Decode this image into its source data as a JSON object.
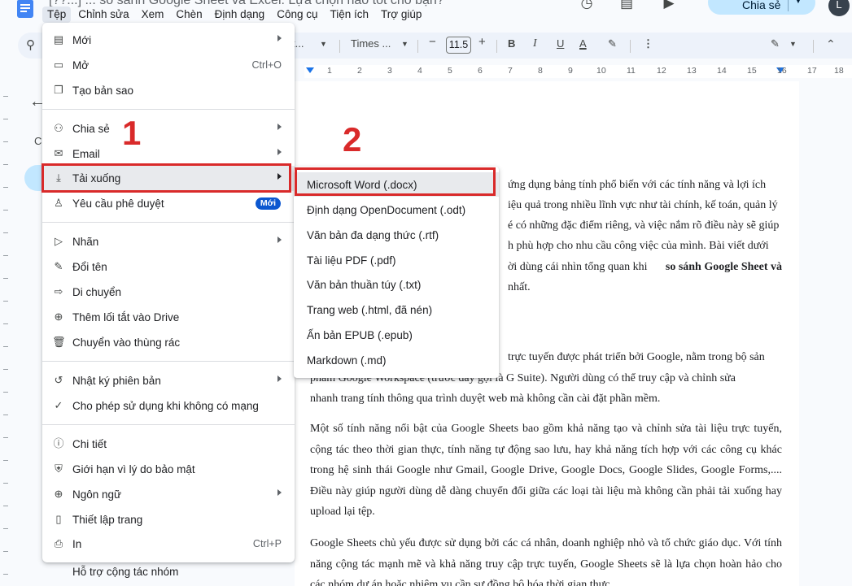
{
  "app": {
    "doc_title": "[??...] ... so sánh Google Sheet và Excel: Lựa chọn nào tốt cho bạn?",
    "menubar": [
      "Tệp",
      "Chỉnh sửa",
      "Xem",
      "Chèn",
      "Định dạng",
      "Công cụ",
      "Tiện ích",
      "Trợ giúp"
    ],
    "share_label": "Chia sẻ",
    "avatar_letter": "L"
  },
  "toolbar": {
    "style_label": "t...",
    "font_label": "Times ...",
    "font_size": "11.5",
    "bold": "B",
    "italic": "I",
    "underline": "U",
    "text_color": "A",
    "minus": "−",
    "plus": "+",
    "more": "⋮"
  },
  "ruler": [
    "1",
    "2",
    "3",
    "4",
    "5",
    "6",
    "7",
    "8",
    "9",
    "10",
    "11",
    "12",
    "13",
    "14",
    "15",
    "16",
    "17",
    "18"
  ],
  "file_menu": {
    "items": [
      {
        "icon": "new-doc-icon",
        "glyph": "▤",
        "label": "Mới",
        "shortcut": "",
        "submenu": true
      },
      {
        "icon": "folder-open-icon",
        "glyph": "▭",
        "label": "Mở",
        "shortcut": "Ctrl+O",
        "submenu": false
      },
      {
        "icon": "copy-icon",
        "glyph": "❐",
        "label": "Tạo bản sao",
        "shortcut": "",
        "submenu": false
      },
      {
        "icon": "person-add-icon",
        "glyph": "⚇",
        "label": "Chia sẻ",
        "shortcut": "",
        "submenu": true
      },
      {
        "icon": "mail-icon",
        "glyph": "✉",
        "label": "Email",
        "shortcut": "",
        "submenu": true
      },
      {
        "icon": "download-icon",
        "glyph": "⤓",
        "label": "Tải xuống",
        "shortcut": "",
        "submenu": true
      },
      {
        "icon": "approval-icon",
        "glyph": "♙",
        "label": "Yêu cầu phê duyệt",
        "shortcut": "",
        "submenu": false,
        "badge": "Mới"
      },
      {
        "icon": "label-icon",
        "glyph": "▷",
        "label": "Nhãn",
        "shortcut": "",
        "submenu": true
      },
      {
        "icon": "rename-icon",
        "glyph": "✎",
        "label": "Đổi tên",
        "shortcut": "",
        "submenu": false
      },
      {
        "icon": "move-icon",
        "glyph": "⇨",
        "label": "Di chuyển",
        "shortcut": "",
        "submenu": false
      },
      {
        "icon": "drive-shortcut-icon",
        "glyph": "⊕",
        "label": "Thêm lối tắt vào Drive",
        "shortcut": "",
        "submenu": false
      },
      {
        "icon": "trash-icon",
        "glyph": "🗑",
        "label": "Chuyển vào thùng rác",
        "shortcut": "",
        "submenu": false
      },
      {
        "icon": "history-icon",
        "glyph": "↺",
        "label": "Nhật ký phiên bản",
        "shortcut": "",
        "submenu": true
      },
      {
        "icon": "offline-icon",
        "glyph": "✓",
        "label": "Cho phép sử dụng khi không có mạng",
        "shortcut": "",
        "submenu": false
      },
      {
        "icon": "info-icon",
        "glyph": "ⓘ",
        "label": "Chi tiết",
        "shortcut": "",
        "submenu": false
      },
      {
        "icon": "security-icon",
        "glyph": "⛨",
        "label": "Giới hạn vì lý do bảo mật",
        "shortcut": "",
        "submenu": false
      },
      {
        "icon": "globe-icon",
        "glyph": "⊕",
        "label": "Ngôn ngữ",
        "shortcut": "",
        "submenu": true
      },
      {
        "icon": "page-setup-icon",
        "glyph": "▯",
        "label": "Thiết lập trang",
        "shortcut": "",
        "submenu": false
      },
      {
        "icon": "print-icon",
        "glyph": "⎙",
        "label": "In",
        "shortcut": "Ctrl+P",
        "submenu": false
      }
    ]
  },
  "download_submenu": {
    "items": [
      "Microsoft Word (.docx)",
      "Định dạng OpenDocument (.odt)",
      "Văn bản đa dạng thức (.rtf)",
      "Tài liệu PDF (.pdf)",
      "Văn bản thuần túy (.txt)",
      "Trang web (.html, đã nén)",
      "Ấn bản EPUB (.epub)",
      "Markdown (.md)"
    ]
  },
  "annotations": {
    "step1": "1",
    "step2": "2",
    "color": "#d92a2a"
  },
  "outline": {
    "collapsed_letter": "C",
    "footer_item": "Hỗ trợ cộng tác nhóm"
  },
  "document": {
    "visible_fragments": [
      "ứng dụng bảng tính phổ biến với các tính năng và lợi ích",
      "iệu quả trong nhiều lĩnh vực như tài chính, kế toán, quản lý",
      "é có những đặc điểm riêng, và việc nắm rõ điều này sẽ giúp",
      "h phù hợp cho nhu cầu công việc của mình. Bài viết dưới",
      "ời dùng cái nhìn tổng quan khi",
      "so sánh Google Sheet và",
      "nhất.",
      "trực tuyến được phát triển bởi Google, nằm trong bộ sản",
      "phẩm Google Workspace (trước đây gọi là G Suite). Người dùng có thể truy cập và chỉnh sửa",
      "nhanh trang tính thông qua trình duyệt web mà không cần cài đặt phần mềm."
    ],
    "para2": "Một số tính năng nổi bật của Google Sheets bao gồm khả năng tạo và chỉnh sửa tài liệu trực tuyến, cộng tác theo thời gian thực, tính năng tự động sao lưu, hay khả năng tích hợp với các công cụ khác trong hệ sinh thái Google như Gmail, Google Drive, Google Docs, Google Slides, Google Forms,.... Điều này giúp người dùng dễ dàng chuyển đổi giữa các loại tài liệu mà không cần phải tải xuống hay upload lại tệp.",
    "para3": "Google Sheets chủ yếu được sử dụng bởi các cá nhân, doanh nghiệp nhỏ và tổ chức giáo dục. Với tính năng cộng tác mạnh mẽ và khả năng truy cập trực tuyến, Google Sheets sẽ là lựa chọn hoàn hảo cho các nhóm dự án hoặc nhiệm vụ cần sự đồng bộ hóa thời gian thực."
  }
}
